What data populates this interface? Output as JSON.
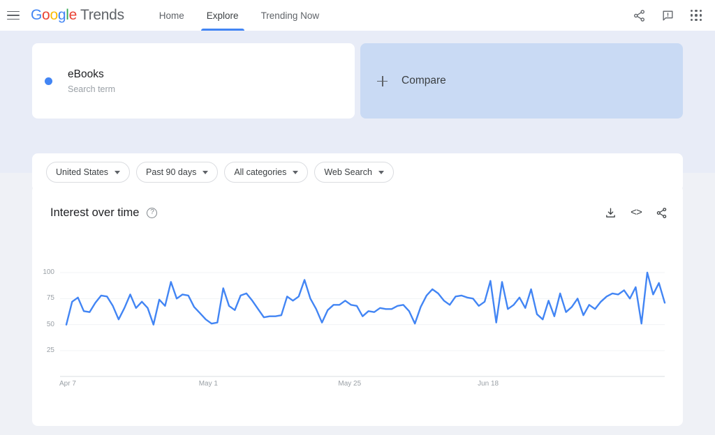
{
  "header": {
    "menu_icon": "hamburger-icon",
    "brand": {
      "google": "Google",
      "product": "Trends"
    },
    "nav": [
      {
        "label": "Home",
        "active": false
      },
      {
        "label": "Explore",
        "active": true
      },
      {
        "label": "Trending Now",
        "active": false
      }
    ],
    "actions": [
      {
        "name": "share-icon",
        "label": "Share"
      },
      {
        "name": "feedback-icon",
        "label": "Send feedback"
      },
      {
        "name": "google-apps-icon",
        "label": "Google apps"
      }
    ]
  },
  "search_term_card": {
    "term": "eBooks",
    "type_label": "Search term",
    "dot_color": "#4285F4"
  },
  "compare_card": {
    "label": "Compare",
    "icon": "plus-icon",
    "background": "#c9daf4"
  },
  "filters": [
    {
      "name": "location-filter",
      "value": "United States"
    },
    {
      "name": "time-range-filter",
      "value": "Past 90 days"
    },
    {
      "name": "category-filter",
      "value": "All categories"
    },
    {
      "name": "search-type-filter",
      "value": "Web Search"
    }
  ],
  "chart_card": {
    "title": "Interest over time",
    "help_icon": "?",
    "actions": [
      {
        "name": "download-csv-icon",
        "label": "Download"
      },
      {
        "name": "embed-code-icon",
        "label": "Embed"
      },
      {
        "name": "share-chart-icon",
        "label": "Share"
      }
    ]
  },
  "chart_data": {
    "type": "line",
    "title": "Interest over time",
    "xlabel": "",
    "ylabel": "",
    "ylim": [
      0,
      105
    ],
    "yticks": [
      100,
      75,
      50,
      25
    ],
    "xticks": [
      "Apr 7",
      "May 1",
      "May 25",
      "Jun 18"
    ],
    "xtick_positions": [
      0,
      24,
      48,
      72
    ],
    "grid": true,
    "legend": false,
    "line_color": "#4285F4",
    "series": [
      {
        "name": "eBooks",
        "values": [
          50,
          72,
          76,
          63,
          62,
          71,
          78,
          77,
          68,
          55,
          66,
          79,
          66,
          72,
          66,
          50,
          74,
          68,
          91,
          75,
          79,
          78,
          67,
          61,
          55,
          51,
          52,
          85,
          68,
          64,
          78,
          80,
          73,
          65,
          57,
          58,
          58,
          59,
          77,
          73,
          77,
          93,
          75,
          65,
          52,
          64,
          69,
          69,
          73,
          69,
          68,
          58,
          63,
          62,
          66,
          65,
          65,
          68,
          69,
          63,
          51,
          67,
          78,
          84,
          80,
          73,
          69,
          77,
          78,
          76,
          75,
          68,
          72,
          92,
          52,
          91,
          65,
          69,
          76,
          66,
          84,
          60,
          55,
          73,
          58,
          80,
          62,
          67,
          75,
          59,
          69,
          65,
          72,
          77,
          80,
          79,
          83,
          75,
          86,
          51,
          100,
          79,
          90,
          71
        ]
      }
    ]
  }
}
